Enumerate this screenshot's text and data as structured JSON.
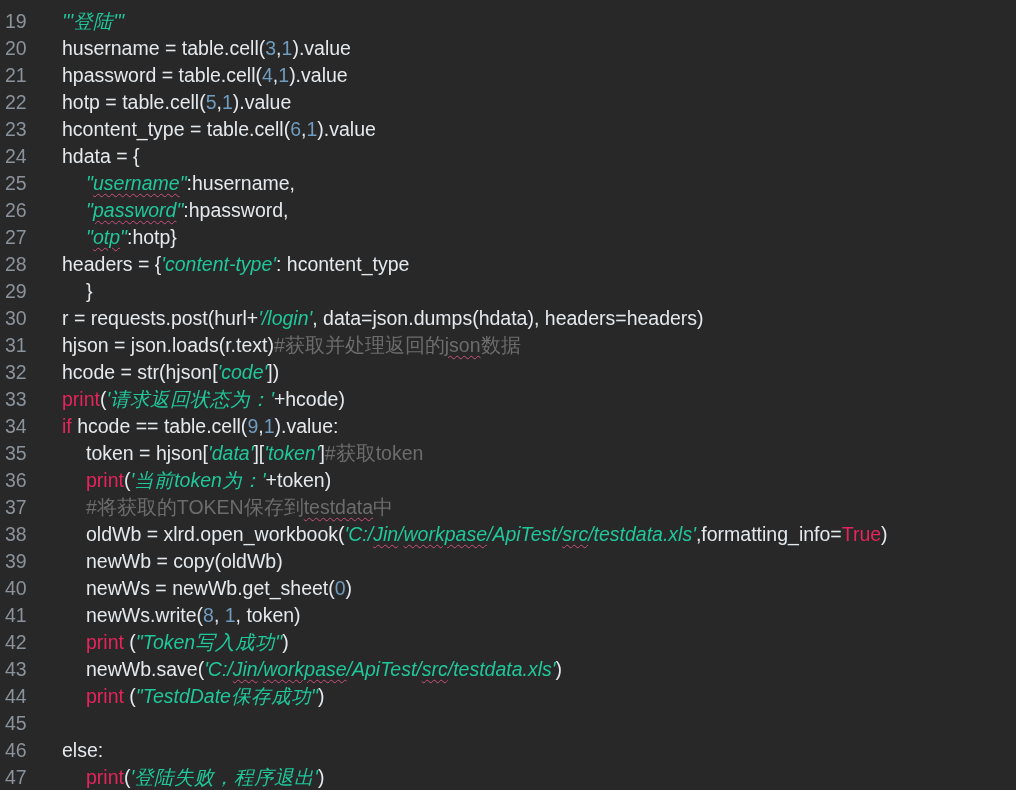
{
  "editor": {
    "lines": [
      {
        "number": "19",
        "tokens": [
          {
            "kind": "string",
            "text": "'''登陆'''"
          }
        ]
      },
      {
        "number": "20",
        "tokens": [
          {
            "kind": "plain",
            "text": "husername = table.cell("
          },
          {
            "kind": "number",
            "text": "3"
          },
          {
            "kind": "plain",
            "text": ","
          },
          {
            "kind": "number",
            "text": "1"
          },
          {
            "kind": "plain",
            "text": ").value"
          }
        ]
      },
      {
        "number": "21",
        "tokens": [
          {
            "kind": "plain",
            "text": "hpassword = table.cell("
          },
          {
            "kind": "number",
            "text": "4"
          },
          {
            "kind": "plain",
            "text": ","
          },
          {
            "kind": "number",
            "text": "1"
          },
          {
            "kind": "plain",
            "text": ").value"
          }
        ]
      },
      {
        "number": "22",
        "tokens": [
          {
            "kind": "plain",
            "text": "hotp = table.cell("
          },
          {
            "kind": "number",
            "text": "5"
          },
          {
            "kind": "plain",
            "text": ","
          },
          {
            "kind": "number",
            "text": "1"
          },
          {
            "kind": "plain",
            "text": ").value"
          }
        ]
      },
      {
        "number": "23",
        "tokens": [
          {
            "kind": "plain",
            "text": "hcontent_type = table.cell("
          },
          {
            "kind": "number",
            "text": "6"
          },
          {
            "kind": "plain",
            "text": ","
          },
          {
            "kind": "number",
            "text": "1"
          },
          {
            "kind": "plain",
            "text": ").value"
          }
        ]
      },
      {
        "number": "24",
        "tokens": [
          {
            "kind": "plain",
            "text": "hdata = {"
          }
        ],
        "children": [
          {
            "number": "25",
            "tokens": [
              {
                "kind": "string",
                "text": "\""
              },
              {
                "kind": "string",
                "text": "username",
                "misspelled": true
              },
              {
                "kind": "string",
                "text": "\""
              },
              {
                "kind": "plain",
                "text": ":husername,"
              }
            ]
          },
          {
            "number": "26",
            "tokens": [
              {
                "kind": "string",
                "text": "\""
              },
              {
                "kind": "string",
                "text": "password",
                "misspelled": true
              },
              {
                "kind": "string",
                "text": "\""
              },
              {
                "kind": "plain",
                "text": ":hpassword,"
              }
            ]
          },
          {
            "number": "27",
            "tokens": [
              {
                "kind": "string",
                "text": "\""
              },
              {
                "kind": "string",
                "text": "otp",
                "misspelled": true
              },
              {
                "kind": "string",
                "text": "\""
              },
              {
                "kind": "plain",
                "text": ":hotp}"
              }
            ]
          }
        ]
      },
      {
        "number": "28",
        "tokens": [
          {
            "kind": "plain",
            "text": "headers = {"
          },
          {
            "kind": "string",
            "text": "'content-type'"
          },
          {
            "kind": "plain",
            "text": ": hcontent_type"
          }
        ],
        "children": [
          {
            "number": "29",
            "tokens": [
              {
                "kind": "plain",
                "text": "}"
              }
            ]
          }
        ]
      },
      {
        "number": "30",
        "tokens": [
          {
            "kind": "plain",
            "text": "r = requests.post(hurl+"
          },
          {
            "kind": "string",
            "text": "'/login'"
          },
          {
            "kind": "plain",
            "text": ", data=json.dumps(hdata), headers=headers)"
          }
        ]
      },
      {
        "number": "31",
        "tokens": [
          {
            "kind": "plain",
            "text": "hjson = json.loads(r.text)"
          },
          {
            "kind": "comment",
            "text": "#获取并处理返回的"
          },
          {
            "kind": "comment",
            "text": "json",
            "misspelled": true
          },
          {
            "kind": "comment",
            "text": "数据"
          }
        ]
      },
      {
        "number": "32",
        "tokens": [
          {
            "kind": "plain",
            "text": "hcode = str(hjson["
          },
          {
            "kind": "string",
            "text": "'code'"
          },
          {
            "kind": "plain",
            "text": "])"
          }
        ]
      },
      {
        "number": "33",
        "tokens": [
          {
            "kind": "keyword",
            "text": "print"
          },
          {
            "kind": "plain",
            "text": "("
          },
          {
            "kind": "string",
            "text": "'请求返回状态为：'"
          },
          {
            "kind": "plain",
            "text": "+hcode)"
          }
        ]
      },
      {
        "number": "34",
        "tokens": [
          {
            "kind": "keyword",
            "text": "if"
          },
          {
            "kind": "plain",
            "text": " hcode == table.cell("
          },
          {
            "kind": "number",
            "text": "9"
          },
          {
            "kind": "plain",
            "text": ","
          },
          {
            "kind": "number",
            "text": "1"
          },
          {
            "kind": "plain",
            "text": ").value:"
          }
        ],
        "children": [
          {
            "number": "35",
            "tokens": [
              {
                "kind": "plain",
                "text": "token = hjson["
              },
              {
                "kind": "string",
                "text": "'data'"
              },
              {
                "kind": "plain",
                "text": "]["
              },
              {
                "kind": "string",
                "text": "'token'"
              },
              {
                "kind": "plain",
                "text": "]"
              },
              {
                "kind": "comment",
                "text": "#获取token"
              }
            ]
          },
          {
            "number": "36",
            "tokens": [
              {
                "kind": "keyword",
                "text": "print"
              },
              {
                "kind": "plain",
                "text": "("
              },
              {
                "kind": "string",
                "text": "'当前token为：'"
              },
              {
                "kind": "plain",
                "text": "+token)"
              }
            ]
          },
          {
            "number": "37",
            "tokens": [
              {
                "kind": "comment",
                "text": "#将获取的TOKEN保存到"
              },
              {
                "kind": "comment",
                "text": "testdata",
                "misspelled": true
              },
              {
                "kind": "comment",
                "text": "中"
              }
            ]
          },
          {
            "number": "38",
            "tokens": [
              {
                "kind": "plain",
                "text": "oldWb = xlrd.open_workbook("
              },
              {
                "kind": "string",
                "text": "'C:/"
              },
              {
                "kind": "string",
                "text": "Jin",
                "misspelled": true
              },
              {
                "kind": "string",
                "text": "/"
              },
              {
                "kind": "string",
                "text": "workpase",
                "misspelled": true
              },
              {
                "kind": "string",
                "text": "/ApiTest/"
              },
              {
                "kind": "string",
                "text": "src",
                "misspelled": true
              },
              {
                "kind": "string",
                "text": "/testdata.xls'"
              },
              {
                "kind": "plain",
                "text": ",formatting_info="
              },
              {
                "kind": "keyword",
                "text": "True"
              },
              {
                "kind": "plain",
                "text": ")"
              }
            ]
          },
          {
            "number": "39",
            "tokens": [
              {
                "kind": "plain",
                "text": "newWb = copy(oldWb)"
              }
            ]
          },
          {
            "number": "40",
            "tokens": [
              {
                "kind": "plain",
                "text": "newWs = newWb.get_sheet("
              },
              {
                "kind": "number",
                "text": "0"
              },
              {
                "kind": "plain",
                "text": ")"
              }
            ]
          },
          {
            "number": "41",
            "tokens": [
              {
                "kind": "plain",
                "text": "newWs.write("
              },
              {
                "kind": "number",
                "text": "8"
              },
              {
                "kind": "plain",
                "text": ", "
              },
              {
                "kind": "number",
                "text": "1"
              },
              {
                "kind": "plain",
                "text": ", token)"
              }
            ]
          },
          {
            "number": "42",
            "tokens": [
              {
                "kind": "keyword",
                "text": "print"
              },
              {
                "kind": "plain",
                "text": " ("
              },
              {
                "kind": "string",
                "text": "\"Token写入成功\""
              },
              {
                "kind": "plain",
                "text": ")"
              }
            ]
          },
          {
            "number": "43",
            "tokens": [
              {
                "kind": "plain",
                "text": "newWb.save("
              },
              {
                "kind": "string",
                "text": "'C:/"
              },
              {
                "kind": "string",
                "text": "Jin",
                "misspelled": true
              },
              {
                "kind": "string",
                "text": "/"
              },
              {
                "kind": "string",
                "text": "workpase",
                "misspelled": true
              },
              {
                "kind": "string",
                "text": "/ApiTest/"
              },
              {
                "kind": "string",
                "text": "src",
                "misspelled": true
              },
              {
                "kind": "string",
                "text": "/testdata.xls'"
              },
              {
                "kind": "plain",
                "text": ")"
              }
            ]
          },
          {
            "number": "44",
            "tokens": [
              {
                "kind": "keyword",
                "text": "print"
              },
              {
                "kind": "plain",
                "text": " ("
              },
              {
                "kind": "string",
                "text": "\"TestdDate保存成功\""
              },
              {
                "kind": "plain",
                "text": ")"
              }
            ]
          },
          {
            "number": "45"
          }
        ]
      },
      {
        "number": "46",
        "tokens": [
          {
            "kind": "plain",
            "text": "else:"
          }
        ],
        "children": [
          {
            "number": "47",
            "tokens": [
              {
                "kind": "keyword",
                "text": "print"
              },
              {
                "kind": "plain",
                "text": "("
              },
              {
                "kind": "string",
                "text": "'登陆失败，程序退出'"
              },
              {
                "kind": "plain",
                "text": ")"
              }
            ]
          }
        ]
      }
    ]
  }
}
